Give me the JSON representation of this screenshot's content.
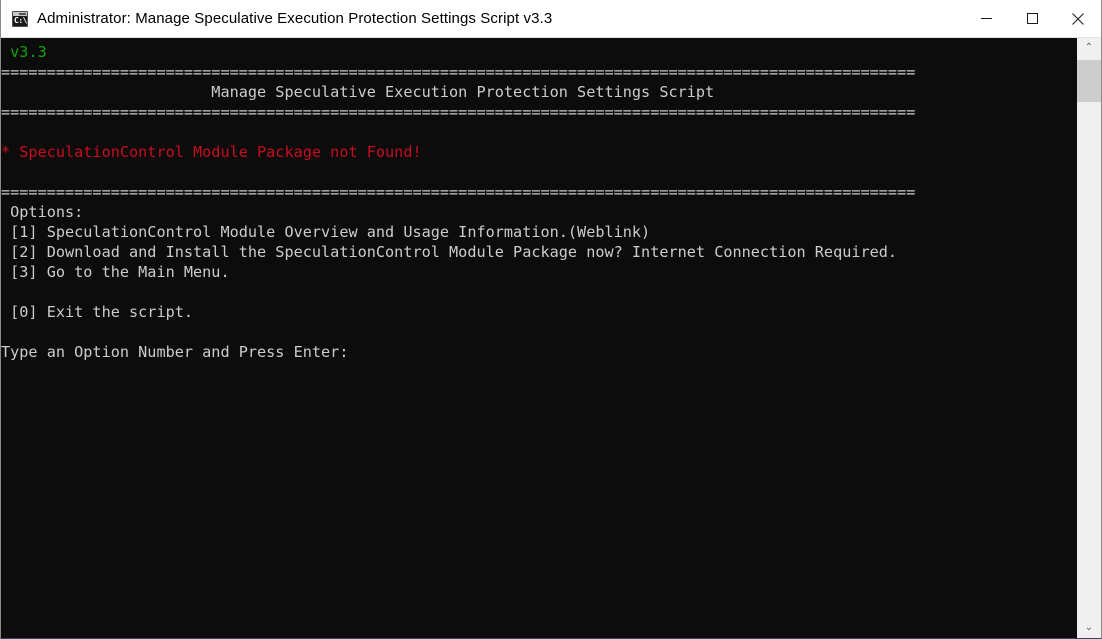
{
  "window": {
    "title": "Administrator:  Manage Speculative Execution Protection Settings Script v3.3",
    "icon_name": "cmd-console-icon",
    "icon_text": "C:\\",
    "controls": {
      "minimize": "Minimize",
      "maximize": "Maximize",
      "close": "Close"
    }
  },
  "colors": {
    "background": "#0c0c0c",
    "foreground": "#cccccc",
    "green": "#13a10e",
    "red": "#c50f1f",
    "titlebar": "#ffffff",
    "scrollbar_track": "#f0f0f0",
    "scrollbar_thumb": "#cdcdcd"
  },
  "console": {
    "version_line": " v3.3",
    "separator": "====================================================================================================",
    "heading": "                       Manage Speculative Execution Protection Settings Script",
    "error_line": "* SpeculationControl Module Package not Found!",
    "options_label": " Options:",
    "options": [
      " [1] SpeculationControl Module Overview and Usage Information.(Weblink)",
      " [2] Download and Install the SpeculationControl Module Package now? Internet Connection Required.",
      " [3] Go to the Main Menu.",
      " [0] Exit the script."
    ],
    "prompt": "Type an Option Number and Press Enter:"
  },
  "scrollbar": {
    "up_arrow": "⌃",
    "down_arrow": "⌄"
  }
}
